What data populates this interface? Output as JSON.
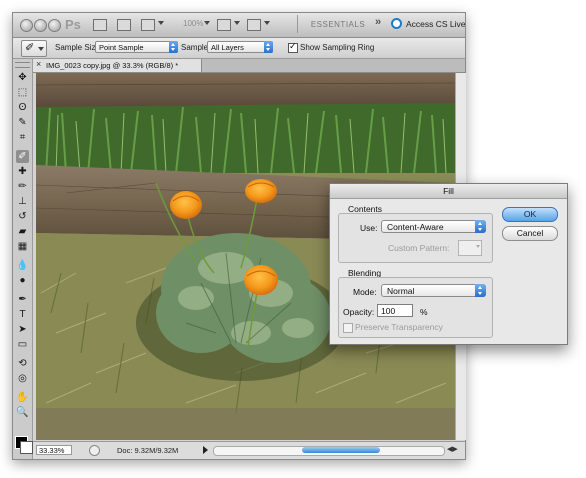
{
  "app": {
    "logo_text": "Ps",
    "zoom_level": "100%",
    "workspace_label": "ESSENTIALS",
    "more_label": "»",
    "cs_live_label": "Access CS Live"
  },
  "options_bar": {
    "sample_size_label": "Sample Size:",
    "sample_size_value": "Point Sample",
    "sample_label": "Sample:",
    "sample_value": "All Layers",
    "show_ring_label": "Show Sampling Ring",
    "show_ring_checked": true
  },
  "document": {
    "tab_close": "×",
    "tab_title": "IMG_0023 copy.jpg @ 33.3% (RGB/8) *",
    "zoom_field": "33.33%",
    "doc_size": "Doc: 9.32M/9.32M"
  },
  "tools": [
    {
      "name": "move-tool-icon",
      "glyph": "✥"
    },
    {
      "name": "marquee-tool-icon",
      "glyph": "⬚"
    },
    {
      "name": "lasso-tool-icon",
      "glyph": "ʘ"
    },
    {
      "name": "quick-select-tool-icon",
      "glyph": "✎"
    },
    {
      "name": "crop-tool-icon",
      "glyph": "⌗"
    },
    {
      "name": "eyedropper-tool-icon",
      "glyph": "✐"
    },
    {
      "name": "healing-brush-tool-icon",
      "glyph": "✚"
    },
    {
      "name": "brush-tool-icon",
      "glyph": "✏"
    },
    {
      "name": "clone-stamp-tool-icon",
      "glyph": "⊥"
    },
    {
      "name": "history-brush-tool-icon",
      "glyph": "↺"
    },
    {
      "name": "eraser-tool-icon",
      "glyph": "▰"
    },
    {
      "name": "gradient-tool-icon",
      "glyph": "▦"
    },
    {
      "name": "blur-tool-icon",
      "glyph": "💧"
    },
    {
      "name": "dodge-tool-icon",
      "glyph": "●"
    },
    {
      "name": "pen-tool-icon",
      "glyph": "✒"
    },
    {
      "name": "type-tool-icon",
      "glyph": "T"
    },
    {
      "name": "path-select-tool-icon",
      "glyph": "➤"
    },
    {
      "name": "shape-tool-icon",
      "glyph": "▭"
    },
    {
      "name": "3d-rotate-tool-icon",
      "glyph": "⟲"
    },
    {
      "name": "3d-orbit-tool-icon",
      "glyph": "◎"
    },
    {
      "name": "hand-tool-icon",
      "glyph": "✋"
    },
    {
      "name": "zoom-tool-icon",
      "glyph": "🔍"
    }
  ],
  "fill_dialog": {
    "title": "Fill",
    "contents_group": "Contents",
    "use_label": "Use:",
    "use_value": "Content-Aware",
    "custom_pattern_label": "Custom Pattern:",
    "blending_group": "Blending",
    "mode_label": "Mode:",
    "mode_value": "Normal",
    "opacity_label": "Opacity:",
    "opacity_value": "100",
    "opacity_unit": "%",
    "preserve_label": "Preserve Transparency",
    "preserve_checked": false,
    "ok_label": "OK",
    "cancel_label": "Cancel"
  }
}
